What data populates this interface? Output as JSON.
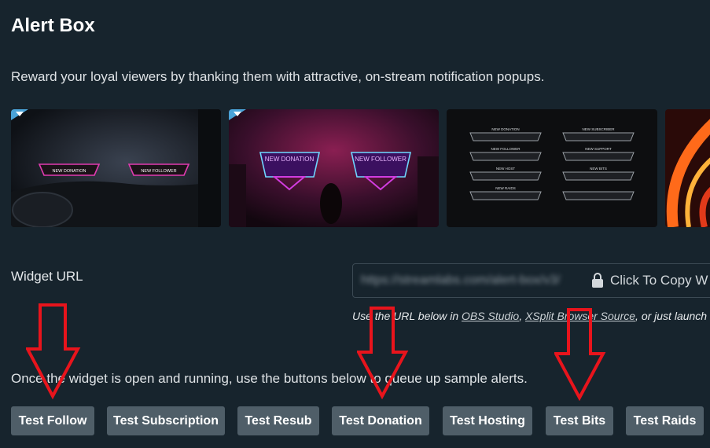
{
  "page": {
    "title": "Alert Box",
    "subtitle": "Reward your loyal viewers by thanking them with attractive, on-stream notification popups."
  },
  "themes": [
    {
      "name": "theme-car-pink",
      "labels": [
        "NEW DONATION",
        "NEW FOLLOWER"
      ]
    },
    {
      "name": "theme-neon-purple",
      "labels": [
        "NEW DONATION",
        "NEW FOLLOWER"
      ]
    },
    {
      "name": "theme-dark-silver",
      "labels": [
        "NEW DONATION",
        "NEW SUBSCRIBER",
        "NEW FOLLOWER",
        "NEW SUPPORT",
        "NEW HOST",
        "NEW BITS",
        "NEW RAIDS"
      ]
    },
    {
      "name": "theme-orange-partial",
      "labels": []
    }
  ],
  "widget": {
    "label": "Widget URL",
    "url_blurred": "https://streamlabs.com/alert-box/v3/",
    "copy_label": "Click To Copy W",
    "hint_prefix": "Use the URL below in ",
    "hint_link1": "OBS Studio",
    "hint_sep": ", ",
    "hint_link2": "XSplit Browser Source",
    "hint_suffix": ", or just launch"
  },
  "instructions": "Once the widget is open and running, use the buttons below to queue up sample alerts.",
  "buttons": {
    "follow": "Test Follow",
    "subscription": "Test Subscription",
    "resub": "Test Resub",
    "donation": "Test Donation",
    "hosting": "Test Hosting",
    "bits": "Test Bits",
    "raids": "Test Raids"
  },
  "colors": {
    "background": "#17242d",
    "button": "#4f5e68",
    "annotation_arrow": "#e8141c"
  },
  "icons": [
    "lock-icon",
    "down-arrow-annotation"
  ]
}
